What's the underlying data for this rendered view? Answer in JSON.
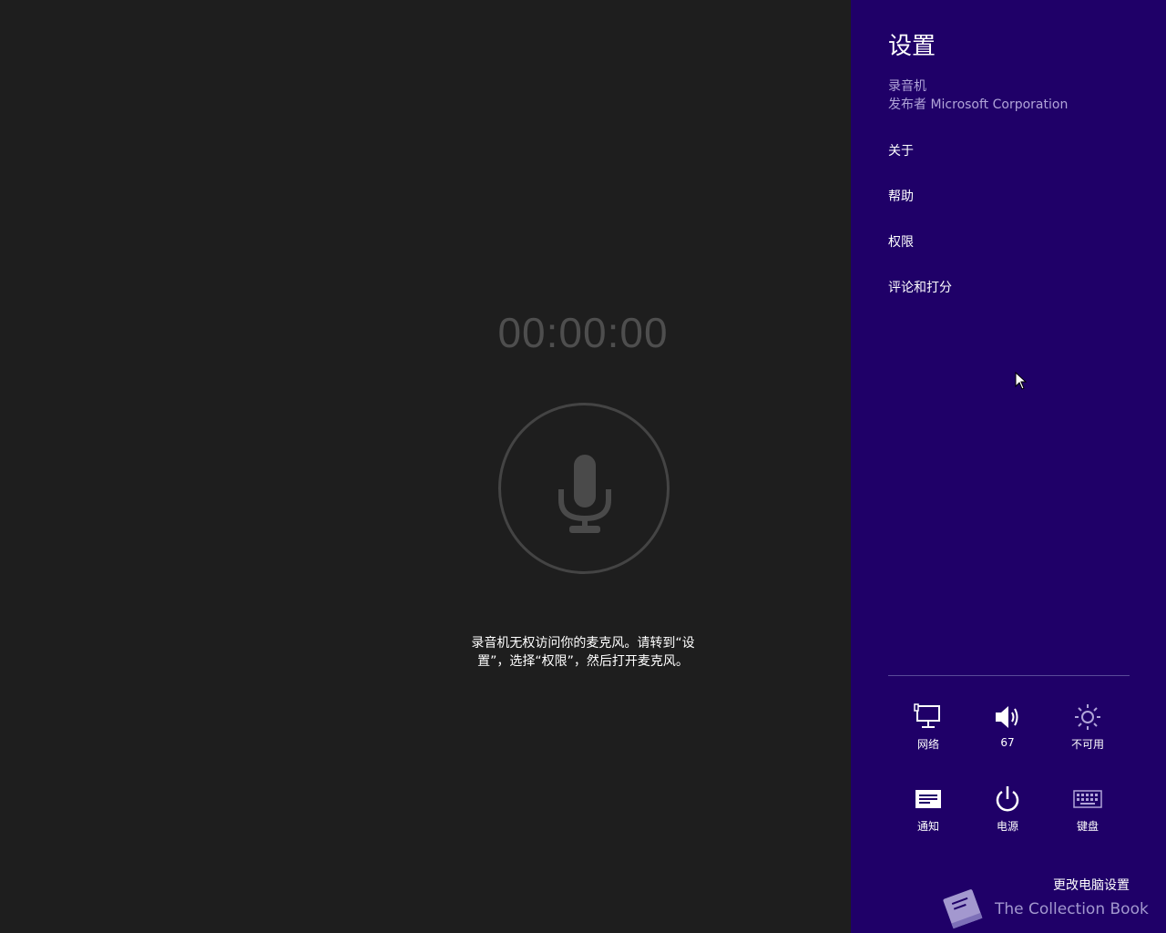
{
  "recorder": {
    "timer": "00:00:00",
    "message": "录音机无权访问你的麦克风。请转到“设置”，选择“权限”，然后打开麦克风。"
  },
  "charm": {
    "title": "设置",
    "app_name": "录音机",
    "publisher": "发布者 Microsoft Corporation",
    "links": [
      "关于",
      "帮助",
      "权限",
      "评论和打分"
    ],
    "quick_settings": [
      {
        "label": "网络",
        "icon": "network-icon"
      },
      {
        "label": "67",
        "icon": "volume-icon"
      },
      {
        "label": "不可用",
        "icon": "brightness-icon"
      },
      {
        "label": "通知",
        "icon": "notifications-icon"
      },
      {
        "label": "电源",
        "icon": "power-icon"
      },
      {
        "label": "键盘",
        "icon": "keyboard-icon"
      }
    ],
    "more_settings": "更改电脑设置"
  },
  "watermark": {
    "text": "The Collection Book"
  },
  "colors": {
    "app_background": "#1e1e1e",
    "charm_background": "#1f0068",
    "accent_text": "#b0a4d8",
    "timer_text": "#4e4e4e"
  }
}
